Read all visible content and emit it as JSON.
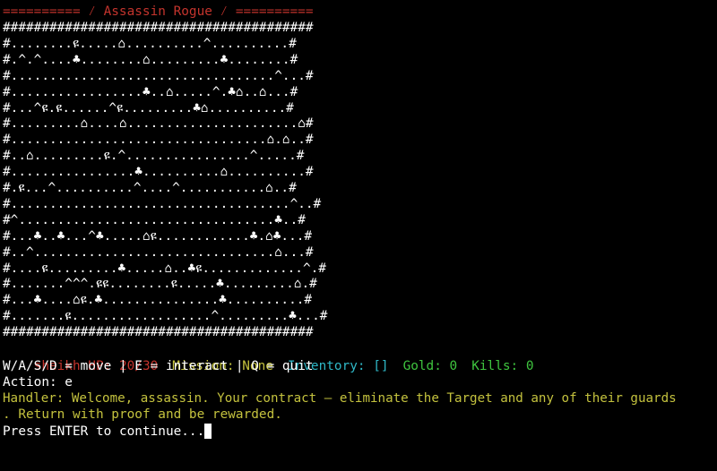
{
  "title": "========== ⁄ Assassin Rogue ⁄ ==========",
  "map_rows": [
    "########################################",
    "#........ዩ.....⌂..........^..........#",
    "#.^.^....♣........⌂.........♣........#",
    "#..................................^...#",
    "#.................♣..⌂.....^.♣⌂..⌂...#",
    "#...^ዩ.ዩ......^ዩ.........♣⌂..........#",
    "#.........⌂....⌂......................⌂#",
    "#.................................⌂.⌂..#",
    "#..⌂.........ዩ.^................^.....#",
    "#................♣..........⌂..........#",
    "#.ዩ...^..........^....^...........⌂..#",
    "#....................................^..#",
    "#^.................................♣..#",
    "#...♣..♣...^♣.....⌂ዩ............♣.⌂♣...#",
    "#..^...............................⌂...#",
    "#....ዩ.........♣.....⌂..♣ዩ.............^.#",
    "#.......^^^.ዩዩ........ዩ.....♣.........⌂.#",
    "#...♣....⌂ዩ.♣...............♣..........#",
    "#.......ዩ..................^.........♣...#",
    "########################################"
  ],
  "status": {
    "name_hp": "sheikh HP: 20/30",
    "mission": "Mission: None",
    "inventory": "Inventory: []",
    "gold": "Gold: 0",
    "kills": "Kills: 0"
  },
  "controls": "W/A/S/D = move | E = interact | Q = quit",
  "action": "Action: e",
  "handler_line1": "Handler: Welcome, assassin. Your contract — eliminate the Target and any of their guards",
  "handler_line2": ". Return with proof and be rewarded.",
  "prompt": "Press ENTER to continue...",
  "colors": {
    "background": "#000000",
    "title_red": "#c4342d",
    "hp_red": "#c4342d",
    "mission_yellow": "#c4c23e",
    "inventory_cyan": "#2fb8c7",
    "gold_green": "#3fc53f",
    "handler_yellow": "#c4c23e",
    "map_white": "#ffffff"
  }
}
